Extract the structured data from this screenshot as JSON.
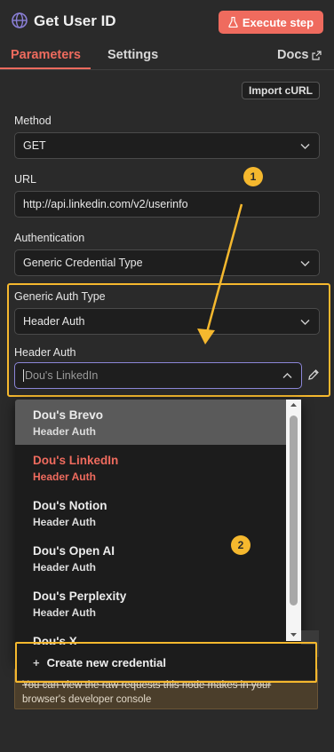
{
  "header": {
    "title": "Get User ID",
    "execute_label": "Execute step"
  },
  "tabs": [
    {
      "label": "Parameters",
      "active": true
    },
    {
      "label": "Settings",
      "active": false
    },
    {
      "label": "Docs",
      "active": false
    }
  ],
  "import_label": "Import cURL",
  "method": {
    "label": "Method",
    "value": "GET"
  },
  "url": {
    "label": "URL",
    "value": "http://api.linkedin.com/v2/userinfo"
  },
  "authentication": {
    "label": "Authentication",
    "value": "Generic Credential Type"
  },
  "generic_auth": {
    "label": "Generic Auth Type",
    "value": "Header Auth"
  },
  "header_auth": {
    "label": "Header Auth",
    "placeholder": "Dou's LinkedIn"
  },
  "dropdown": {
    "items": [
      {
        "name": "Dou's Brevo",
        "sub": "Header Auth"
      },
      {
        "name": "Dou's LinkedIn",
        "sub": "Header Auth"
      },
      {
        "name": "Dou's Notion",
        "sub": "Header Auth"
      },
      {
        "name": "Dou's Open AI",
        "sub": "Header Auth"
      },
      {
        "name": "Dou's Perplexity",
        "sub": "Header Auth"
      },
      {
        "name": "Dou's X",
        "sub": ""
      }
    ],
    "create_label": "Create new credential"
  },
  "hint": {
    "line1": "You can view the raw requests this node makes in your",
    "line2": "browser's developer console"
  },
  "annotations": {
    "badge1": "1",
    "badge2": "2"
  },
  "colors": {
    "accent": "#ef6b5e",
    "highlight": "#f5b82e",
    "panel": "#2a2a2a"
  }
}
